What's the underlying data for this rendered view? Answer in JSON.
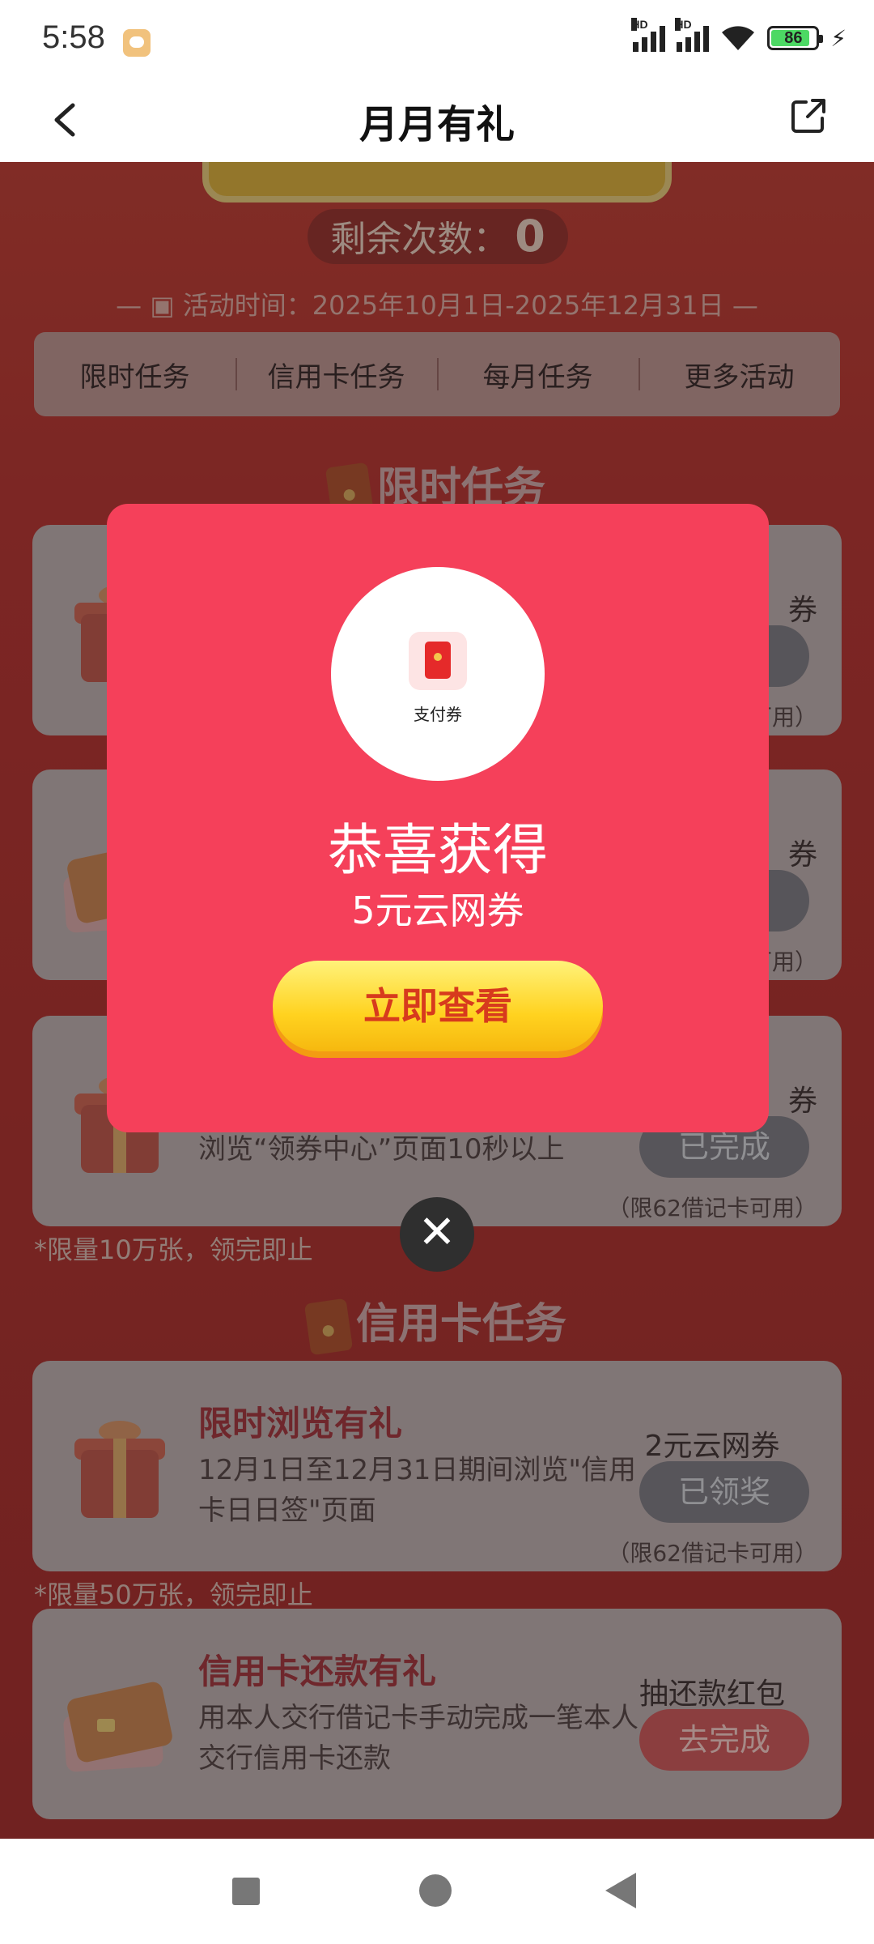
{
  "status_bar": {
    "time": "5:58",
    "network1": "HD",
    "network2": "HD",
    "battery": "86"
  },
  "header": {
    "title": "月月有礼"
  },
  "activity": {
    "remaining_label": "剩余次数：",
    "remaining_value": "0",
    "time_text": "活动时间：2025年10月1日-2025年12月31日"
  },
  "tabs": [
    "限时任务",
    "信用卡任务",
    "每月任务",
    "更多活动"
  ],
  "sections": {
    "limited": "限时任务",
    "credit": "信用卡任务"
  },
  "limited_cards": [
    {
      "reward": "券",
      "note": "可用）"
    },
    {
      "reward": "券",
      "note": "可用）"
    },
    {
      "desc": "浏览“领券中心”页面10秒以上",
      "reward": "券",
      "action": "已完成",
      "note": "（限62借记卡可用）"
    }
  ],
  "limited_note": "*限量10万张，领完即止",
  "credit_cards": [
    {
      "title": "限时浏览有礼",
      "desc": "12月1日至12月31日期间浏览\"信用卡日日签\"页面",
      "reward": "2元云网券",
      "action": "已领奖",
      "note": "（限62借记卡可用）"
    },
    {
      "title": "信用卡还款有礼",
      "desc": "用本人交行借记卡手动完成一笔本人交行信用卡还款",
      "reward": "抽还款红包",
      "action": "去完成"
    }
  ],
  "credit_note": "*限量50万张，领完即止",
  "modal": {
    "prize_label": "支付券",
    "congrats": "恭喜获得",
    "prize_name": "5元云网券",
    "view_button": "立即查看",
    "close": "✕"
  },
  "colors": {
    "modal_bg": "#f5405a",
    "button_yellow": "#ffd21f",
    "accent_red": "#9b2730"
  }
}
